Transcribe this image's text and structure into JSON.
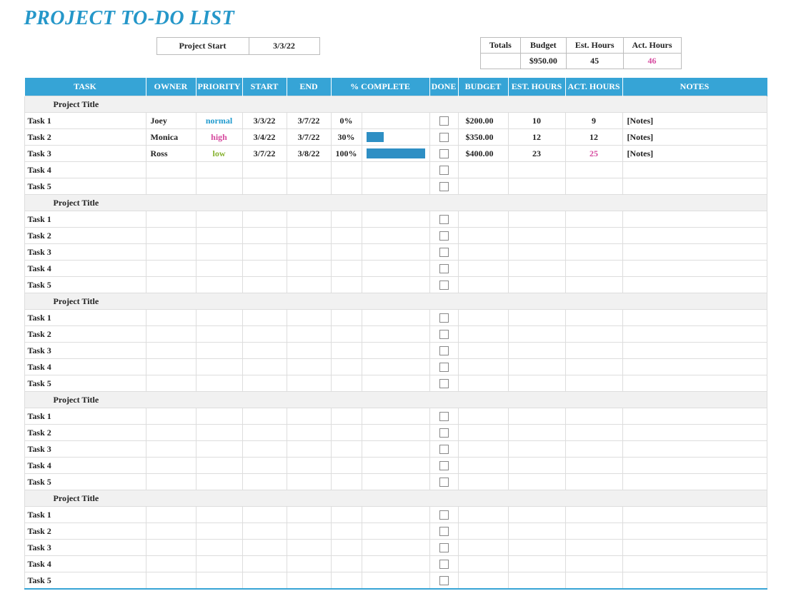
{
  "title": "PROJECT TO-DO LIST",
  "project_start_label": "Project Start",
  "project_start_value": "3/3/22",
  "totals": {
    "headers": [
      "Totals",
      "Budget",
      "Est. Hours",
      "Act. Hours"
    ],
    "values": [
      "",
      "$950.00",
      "45",
      "46"
    ]
  },
  "columns": [
    "TASK",
    "OWNER",
    "PRIORITY",
    "START",
    "END",
    "% COMPLETE",
    "",
    "DONE",
    "BUDGET",
    "EST. HOURS",
    "ACT. HOURS",
    "NOTES"
  ],
  "groups": [
    {
      "title": "Project Title",
      "tasks": [
        {
          "name": "Task 1",
          "owner": "Joey",
          "priority": "normal",
          "prio_class": "prio-normal",
          "start": "3/3/22",
          "end": "3/7/22",
          "pct": "0%",
          "bar": 0,
          "done": false,
          "budget": "$200.00",
          "est": "10",
          "act": "9",
          "act_pink": false,
          "notes": "[Notes]"
        },
        {
          "name": "Task 2",
          "owner": "Monica",
          "priority": "high",
          "prio_class": "prio-high",
          "start": "3/4/22",
          "end": "3/7/22",
          "pct": "30%",
          "bar": 30,
          "done": false,
          "budget": "$350.00",
          "est": "12",
          "act": "12",
          "act_pink": false,
          "notes": "[Notes]"
        },
        {
          "name": "Task 3",
          "owner": "Ross",
          "priority": "low",
          "prio_class": "prio-low",
          "start": "3/7/22",
          "end": "3/8/22",
          "pct": "100%",
          "bar": 100,
          "done": false,
          "budget": "$400.00",
          "est": "23",
          "act": "25",
          "act_pink": true,
          "notes": "[Notes]"
        },
        {
          "name": "Task 4",
          "owner": "",
          "priority": "",
          "prio_class": "",
          "start": "",
          "end": "",
          "pct": "",
          "bar": null,
          "done": false,
          "budget": "",
          "est": "",
          "act": "",
          "act_pink": false,
          "notes": ""
        },
        {
          "name": "Task 5",
          "owner": "",
          "priority": "",
          "prio_class": "",
          "start": "",
          "end": "",
          "pct": "",
          "bar": null,
          "done": false,
          "budget": "",
          "est": "",
          "act": "",
          "act_pink": false,
          "notes": ""
        }
      ]
    },
    {
      "title": "Project Title",
      "tasks": [
        {
          "name": "Task 1",
          "owner": "",
          "priority": "",
          "prio_class": "",
          "start": "",
          "end": "",
          "pct": "",
          "bar": null,
          "done": false,
          "budget": "",
          "est": "",
          "act": "",
          "act_pink": false,
          "notes": ""
        },
        {
          "name": "Task 2",
          "owner": "",
          "priority": "",
          "prio_class": "",
          "start": "",
          "end": "",
          "pct": "",
          "bar": null,
          "done": false,
          "budget": "",
          "est": "",
          "act": "",
          "act_pink": false,
          "notes": ""
        },
        {
          "name": "Task 3",
          "owner": "",
          "priority": "",
          "prio_class": "",
          "start": "",
          "end": "",
          "pct": "",
          "bar": null,
          "done": false,
          "budget": "",
          "est": "",
          "act": "",
          "act_pink": false,
          "notes": ""
        },
        {
          "name": "Task 4",
          "owner": "",
          "priority": "",
          "prio_class": "",
          "start": "",
          "end": "",
          "pct": "",
          "bar": null,
          "done": false,
          "budget": "",
          "est": "",
          "act": "",
          "act_pink": false,
          "notes": ""
        },
        {
          "name": "Task 5",
          "owner": "",
          "priority": "",
          "prio_class": "",
          "start": "",
          "end": "",
          "pct": "",
          "bar": null,
          "done": false,
          "budget": "",
          "est": "",
          "act": "",
          "act_pink": false,
          "notes": ""
        }
      ]
    },
    {
      "title": "Project Title",
      "tasks": [
        {
          "name": "Task 1",
          "owner": "",
          "priority": "",
          "prio_class": "",
          "start": "",
          "end": "",
          "pct": "",
          "bar": null,
          "done": false,
          "budget": "",
          "est": "",
          "act": "",
          "act_pink": false,
          "notes": ""
        },
        {
          "name": "Task 2",
          "owner": "",
          "priority": "",
          "prio_class": "",
          "start": "",
          "end": "",
          "pct": "",
          "bar": null,
          "done": false,
          "budget": "",
          "est": "",
          "act": "",
          "act_pink": false,
          "notes": ""
        },
        {
          "name": "Task 3",
          "owner": "",
          "priority": "",
          "prio_class": "",
          "start": "",
          "end": "",
          "pct": "",
          "bar": null,
          "done": false,
          "budget": "",
          "est": "",
          "act": "",
          "act_pink": false,
          "notes": ""
        },
        {
          "name": "Task 4",
          "owner": "",
          "priority": "",
          "prio_class": "",
          "start": "",
          "end": "",
          "pct": "",
          "bar": null,
          "done": false,
          "budget": "",
          "est": "",
          "act": "",
          "act_pink": false,
          "notes": ""
        },
        {
          "name": "Task 5",
          "owner": "",
          "priority": "",
          "prio_class": "",
          "start": "",
          "end": "",
          "pct": "",
          "bar": null,
          "done": false,
          "budget": "",
          "est": "",
          "act": "",
          "act_pink": false,
          "notes": ""
        }
      ]
    },
    {
      "title": "Project Title",
      "tasks": [
        {
          "name": "Task 1",
          "owner": "",
          "priority": "",
          "prio_class": "",
          "start": "",
          "end": "",
          "pct": "",
          "bar": null,
          "done": false,
          "budget": "",
          "est": "",
          "act": "",
          "act_pink": false,
          "notes": ""
        },
        {
          "name": "Task 2",
          "owner": "",
          "priority": "",
          "prio_class": "",
          "start": "",
          "end": "",
          "pct": "",
          "bar": null,
          "done": false,
          "budget": "",
          "est": "",
          "act": "",
          "act_pink": false,
          "notes": ""
        },
        {
          "name": "Task 3",
          "owner": "",
          "priority": "",
          "prio_class": "",
          "start": "",
          "end": "",
          "pct": "",
          "bar": null,
          "done": false,
          "budget": "",
          "est": "",
          "act": "",
          "act_pink": false,
          "notes": ""
        },
        {
          "name": "Task 4",
          "owner": "",
          "priority": "",
          "prio_class": "",
          "start": "",
          "end": "",
          "pct": "",
          "bar": null,
          "done": false,
          "budget": "",
          "est": "",
          "act": "",
          "act_pink": false,
          "notes": ""
        },
        {
          "name": "Task 5",
          "owner": "",
          "priority": "",
          "prio_class": "",
          "start": "",
          "end": "",
          "pct": "",
          "bar": null,
          "done": false,
          "budget": "",
          "est": "",
          "act": "",
          "act_pink": false,
          "notes": ""
        }
      ]
    },
    {
      "title": "Project Title",
      "tasks": [
        {
          "name": "Task 1",
          "owner": "",
          "priority": "",
          "prio_class": "",
          "start": "",
          "end": "",
          "pct": "",
          "bar": null,
          "done": false,
          "budget": "",
          "est": "",
          "act": "",
          "act_pink": false,
          "notes": ""
        },
        {
          "name": "Task 2",
          "owner": "",
          "priority": "",
          "prio_class": "",
          "start": "",
          "end": "",
          "pct": "",
          "bar": null,
          "done": false,
          "budget": "",
          "est": "",
          "act": "",
          "act_pink": false,
          "notes": ""
        },
        {
          "name": "Task 3",
          "owner": "",
          "priority": "",
          "prio_class": "",
          "start": "",
          "end": "",
          "pct": "",
          "bar": null,
          "done": false,
          "budget": "",
          "est": "",
          "act": "",
          "act_pink": false,
          "notes": ""
        },
        {
          "name": "Task 4",
          "owner": "",
          "priority": "",
          "prio_class": "",
          "start": "",
          "end": "",
          "pct": "",
          "bar": null,
          "done": false,
          "budget": "",
          "est": "",
          "act": "",
          "act_pink": false,
          "notes": ""
        },
        {
          "name": "Task 5",
          "owner": "",
          "priority": "",
          "prio_class": "",
          "start": "",
          "end": "",
          "pct": "",
          "bar": null,
          "done": false,
          "budget": "",
          "est": "",
          "act": "",
          "act_pink": false,
          "notes": ""
        }
      ]
    }
  ]
}
